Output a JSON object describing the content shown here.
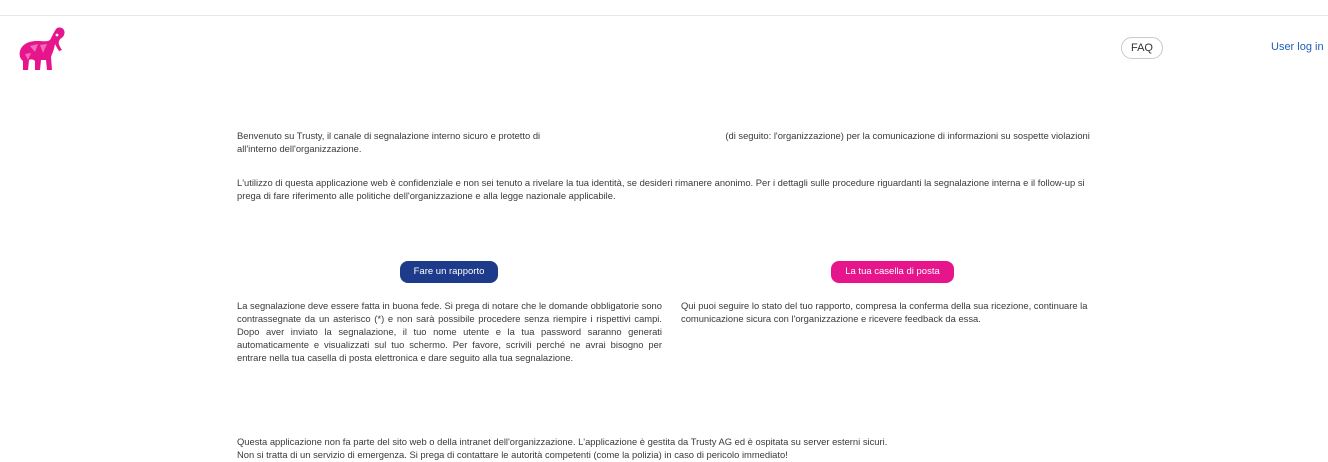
{
  "header": {
    "logo_icon": "elephant-logo-icon",
    "faq_label": "FAQ",
    "login_label": "User log in"
  },
  "intro": {
    "p1_part1": "Benvenuto su Trusty, il canale di segnalazione interno sicuro e protetto di",
    "p1_part2": "(di seguito: l'organizzazione) per la comunicazione di informazioni su sospette violazioni all'interno dell'organizzazione.",
    "p2": "L'utilizzo di questa applicazione web è confidenziale e non sei tenuto a rivelare la tua identità, se desideri rimanere anonimo. Per i dettagli sulle procedure riguardanti la segnalazione interna e il follow-up si prega di fare riferimento alle politiche dell'organizzazione e alla legge nazionale applicabile."
  },
  "report": {
    "button_label": "Fare un rapporto",
    "description": "La segnalazione deve essere fatta in buona fede. Si prega di notare che le domande obbligatorie sono contrassegnate da un asterisco (*) e non sarà possibile procedere senza riempire i rispettivi campi. Dopo aver inviato la segnalazione, il tuo nome utente e la tua password saranno generati automaticamente e visualizzati sul tuo schermo. Per favore, scrivili perché ne avrai bisogno per entrare nella tua casella di posta elettronica e dare seguito alla tua segnalazione."
  },
  "inbox": {
    "button_label": "La tua casella di posta",
    "description": "Qui puoi seguire lo stato del tuo rapporto, compresa la conferma della sua ricezione, continuare la comunicazione sicura con l'organizzazione e ricevere feedback da essa."
  },
  "footer": {
    "line1": "Questa applicazione non fa parte del sito web o della intranet dell'organizzazione. L'applicazione è gestita da Trusty AG ed è ospitata su server esterni sicuri.",
    "line2": "Non si tratta di un servizio di emergenza. Si prega di contattare le autorità competenti (come la polizia) in caso di pericolo immediato!"
  },
  "colors": {
    "brand_pink": "#e6158c",
    "brand_blue": "#1e3a8a",
    "link_blue": "#1f5fb5"
  }
}
